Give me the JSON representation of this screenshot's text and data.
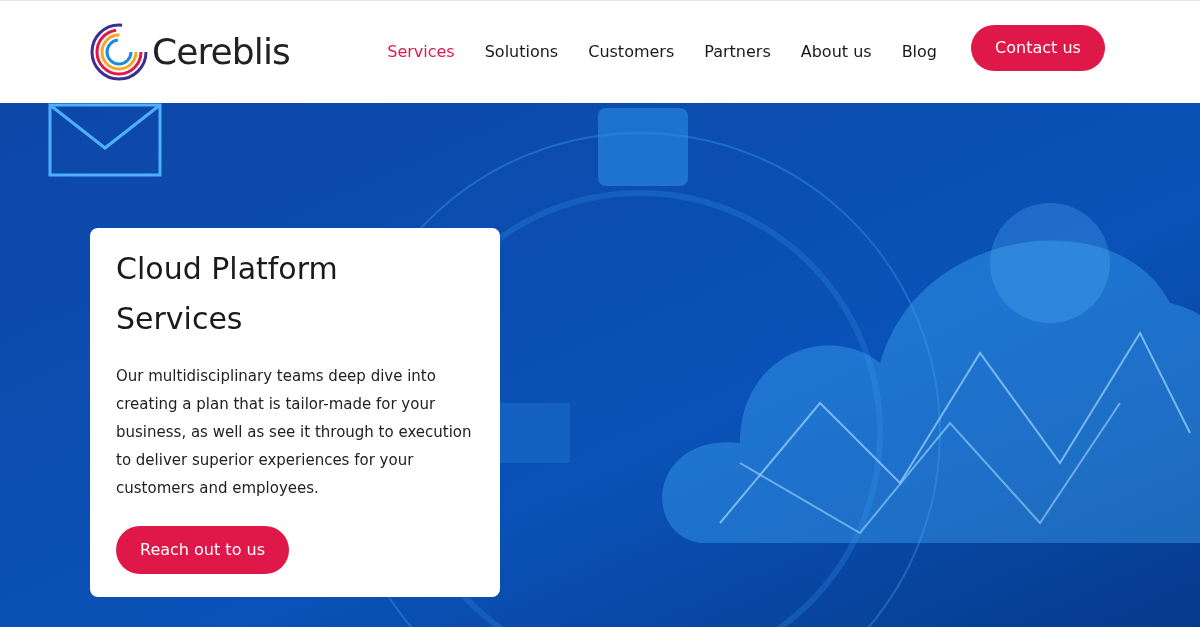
{
  "header": {
    "logo": "Cereblis",
    "nav": [
      {
        "label": "Services",
        "selected": true
      },
      {
        "label": "Solutions",
        "selected": false
      },
      {
        "label": "Customers",
        "selected": false
      },
      {
        "label": "Partners",
        "selected": false
      },
      {
        "label": "About us",
        "selected": false
      },
      {
        "label": "Blog",
        "selected": false
      }
    ],
    "cta": "Contact us"
  },
  "hero": {
    "card": {
      "title": "Cloud Platform Services",
      "body": "Our multidisciplinary teams deep dive into creating a plan that is tailor-made for your business, as well as see it through to execution to deliver superior experiences for your customers and employees.",
      "button": "Reach out to us"
    }
  }
}
